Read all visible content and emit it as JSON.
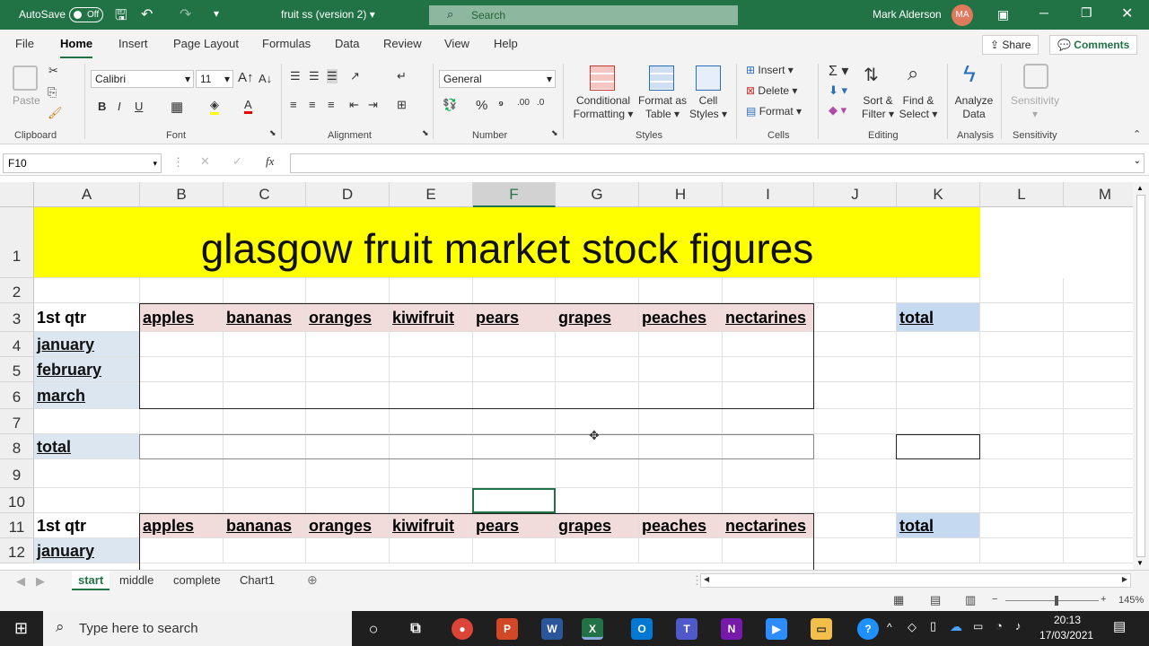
{
  "titlebar": {
    "autosave_label": "AutoSave",
    "autosave_state": "Off",
    "file_title": "fruit ss (version 2)",
    "search_placeholder": "Search",
    "user_name": "Mark Alderson",
    "user_initials": "MA"
  },
  "menu": {
    "tabs": [
      "File",
      "Home",
      "Insert",
      "Page Layout",
      "Formulas",
      "Data",
      "Review",
      "View",
      "Help"
    ],
    "active": "Home",
    "share_label": "Share",
    "comments_label": "Comments"
  },
  "ribbon": {
    "clipboard": {
      "paste": "Paste",
      "group": "Clipboard"
    },
    "font": {
      "name": "Calibri",
      "size": "11",
      "group": "Font"
    },
    "alignment": {
      "group": "Alignment"
    },
    "number": {
      "format": "General",
      "group": "Number"
    },
    "styles": {
      "conditional_1": "Conditional",
      "conditional_2": "Formatting",
      "format_table_1": "Format as",
      "format_table_2": "Table",
      "cell_styles_1": "Cell",
      "cell_styles_2": "Styles",
      "group": "Styles"
    },
    "cells": {
      "insert": "Insert",
      "delete": "Delete",
      "format": "Format",
      "group": "Cells"
    },
    "editing": {
      "sort_1": "Sort &",
      "sort_2": "Filter",
      "find_1": "Find &",
      "find_2": "Select",
      "group": "Editing"
    },
    "analysis": {
      "analyze_1": "Analyze",
      "analyze_2": "Data",
      "group": "Analysis"
    },
    "sensitivity": {
      "label": "Sensitivity",
      "group": "Sensitivity"
    }
  },
  "formula_bar": {
    "name_box": "F10",
    "fx": "fx",
    "formula": ""
  },
  "sheet": {
    "columns": [
      "A",
      "B",
      "C",
      "D",
      "E",
      "F",
      "G",
      "H",
      "I",
      "J",
      "K",
      "L",
      "M"
    ],
    "selected_column": "F",
    "rows": [
      "1",
      "2",
      "3",
      "4",
      "5",
      "6",
      "7",
      "8",
      "9",
      "10",
      "11",
      "12"
    ],
    "title": "glasgow fruit market stock figures",
    "quarter_label": "1st qtr",
    "fruits": [
      "apples",
      "bananas",
      "oranges",
      "kiwifruit",
      "pears",
      "grapes",
      "peaches",
      "nectarines"
    ],
    "months": [
      "january",
      "february",
      "march"
    ],
    "total_label": "total",
    "active_cell": "F10"
  },
  "sheet_tabs": {
    "tabs": [
      "start",
      "middle",
      "complete",
      "Chart1"
    ],
    "active": "start"
  },
  "status": {
    "zoom": "145%"
  },
  "taskbar": {
    "search_placeholder": "Type here to search",
    "time": "20:13",
    "date": "17/03/2021"
  },
  "colors": {
    "excel_green": "#217346",
    "title_fill": "#ffff00",
    "fruit_fill": "#f2dcdb",
    "month_fill": "#dce6f1",
    "total_fill": "#c5d9f1"
  }
}
